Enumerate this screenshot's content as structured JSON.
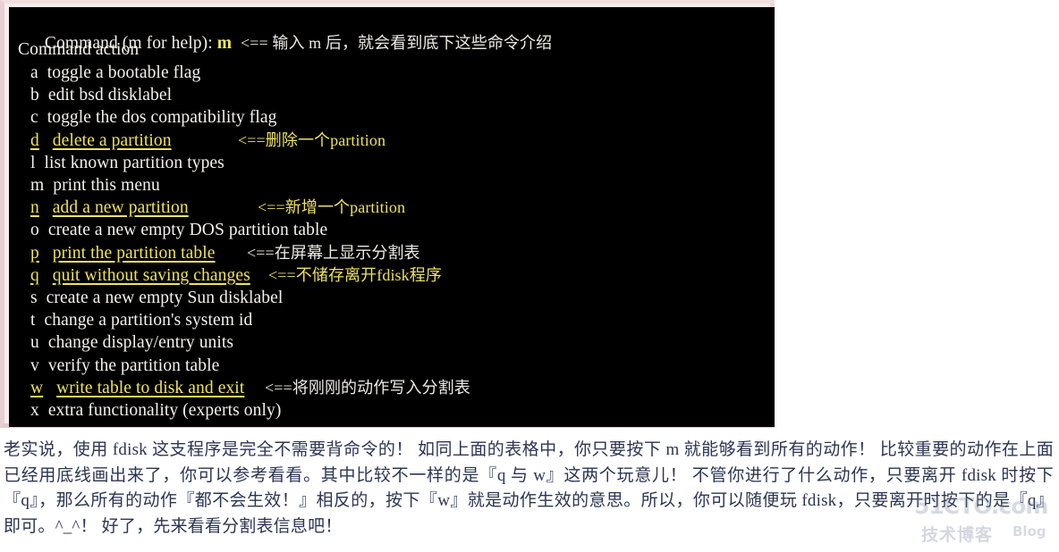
{
  "terminal": {
    "prompt": {
      "label": "Command (m for help):",
      "typed_key": "m",
      "annotation": "<== 输入 m 后，就会看到底下这些命令介绍"
    },
    "menu_heading": "Command action",
    "options": [
      {
        "key": "a",
        "label": "toggle a bootable flag",
        "highlighted": false,
        "annotation": "",
        "annotation_color": ""
      },
      {
        "key": "b",
        "label": "edit bsd disklabel",
        "highlighted": false,
        "annotation": "",
        "annotation_color": ""
      },
      {
        "key": "c",
        "label": "toggle the dos compatibility flag",
        "highlighted": false,
        "annotation": "",
        "annotation_color": ""
      },
      {
        "key": "d",
        "label": "delete a partition",
        "highlighted": true,
        "annotation": "<==删除一个partition",
        "annotation_color": "yellow"
      },
      {
        "key": "l",
        "label": "list known partition types",
        "highlighted": false,
        "annotation": "",
        "annotation_color": ""
      },
      {
        "key": "m",
        "label": "print this menu",
        "highlighted": false,
        "annotation": "",
        "annotation_color": ""
      },
      {
        "key": "n",
        "label": "add a new partition",
        "highlighted": true,
        "annotation": "<==新增一个partition",
        "annotation_color": "yellow"
      },
      {
        "key": "o",
        "label": "create a new empty DOS partition table",
        "highlighted": false,
        "annotation": "",
        "annotation_color": ""
      },
      {
        "key": "p",
        "label": "print the partition table",
        "highlighted": true,
        "annotation": "<==在屏幕上显示分割表",
        "annotation_color": "white"
      },
      {
        "key": "q",
        "label": "quit without saving changes",
        "highlighted": true,
        "annotation": "<==不储存离开fdisk程序",
        "annotation_color": "yellow"
      },
      {
        "key": "s",
        "label": "create a new empty Sun disklabel",
        "highlighted": false,
        "annotation": "",
        "annotation_color": ""
      },
      {
        "key": "t",
        "label": "change a partition's system id",
        "highlighted": false,
        "annotation": "",
        "annotation_color": ""
      },
      {
        "key": "u",
        "label": "change display/entry units",
        "highlighted": false,
        "annotation": "",
        "annotation_color": ""
      },
      {
        "key": "v",
        "label": "verify the partition table",
        "highlighted": false,
        "annotation": "",
        "annotation_color": ""
      },
      {
        "key": "w",
        "label": "write table to disk and exit",
        "highlighted": true,
        "annotation": "<==将刚刚的动作写入分割表",
        "annotation_color": "white"
      },
      {
        "key": "x",
        "label": "extra functionality (experts only)",
        "highlighted": false,
        "annotation": "",
        "annotation_color": ""
      }
    ]
  },
  "prose": {
    "paragraph": "老实说，使用 fdisk 这支程序是完全不需要背命令的！ 如同上面的表格中，你只要按下 m 就能够看到所有的动作！ 比较重要的动作在上面已经用底线画出来了，你可以参考看看。其中比较不一样的是『q 与 w』这两个玩意儿！ 不管你进行了什么动作，只要离开 fdisk 时按下『q』，那么所有的动作『都不会生效！』相反的，按下『w』就是动作生效的意思。所以，你可以随便玩 fdisk，只要离开时按下的是『q』即可。^_^！ 好了，先来看看分割表信息吧！"
  },
  "watermark": {
    "main": "51CTO.com",
    "sub": "技术博客",
    "blog": "Blog"
  },
  "colors": {
    "terminal_bg": "#000000",
    "terminal_text": "#f4f2ee",
    "highlight_yellow": "#f0e45a",
    "window_border": "#f2dede",
    "prose_text": "#2c3553"
  }
}
